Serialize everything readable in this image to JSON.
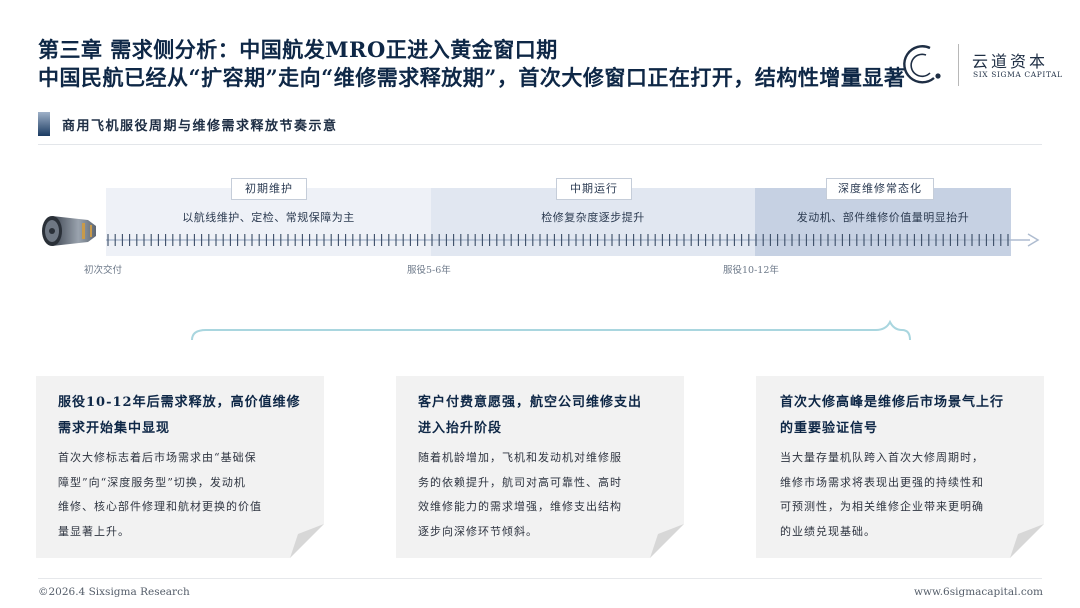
{
  "header": {
    "title": "第三章 需求侧分析：中国航发MRO正进入黄金窗口期",
    "subtitle": "中国民航已经从“扩容期”走向“维修需求释放期”，首次大修窗口正在打开，结构性增量显著"
  },
  "brand": {
    "name_cn": "云道资本",
    "name_en": "SIX SIGMA CAPITAL",
    "accent": "#0e2746"
  },
  "section": {
    "title": "商用飞机服役周期与维修需求释放节奏示意"
  },
  "timeline": {
    "phases": [
      {
        "tag": "初期维护",
        "text": "以航线维护、定检、常规保障为主"
      },
      {
        "tag": "中期运行",
        "text": "检修复杂度逐步提升"
      },
      {
        "tag": "深度维修常态化",
        "text": "发动机、部件维修价值量明显抬升"
      }
    ],
    "milestones": [
      "初次交付",
      "服役5-6年",
      "服役10-12年"
    ]
  },
  "cards": [
    {
      "title_lines": [
        "服役10-12年后需求释放，高价值维修",
        "需求开始集中显现"
      ],
      "body_lines": [
        "首次大修标志着后市场需求由“基础保",
        "障型”向“深度服务型”切换，发动机",
        "维修、核心部件修理和航材更换的价值",
        "量显著上升。"
      ]
    },
    {
      "title_lines": [
        "客户付费意愿强，航空公司维修支出",
        "进入抬升阶段"
      ],
      "body_lines": [
        "随着机龄增加，飞机和发动机对维修服",
        "务的依赖提升，航司对高可靠性、高时",
        "效维修能力的需求增强，维修支出结构",
        "逐步向深修环节倾斜。"
      ]
    },
    {
      "title_lines": [
        "首次大修高峰是维修后市场景气上行",
        "的重要验证信号"
      ],
      "body_lines": [
        "当大量存量机队跨入首次大修周期时，",
        "维修市场需求将表现出更强的持续性和",
        "可预测性，为相关维修企业带来更明确",
        "的业绩兑现基础。"
      ]
    }
  ],
  "footer": {
    "copyright": "©2026.4 Sixsigma Research",
    "website": "www.6sigmacapital.com"
  }
}
